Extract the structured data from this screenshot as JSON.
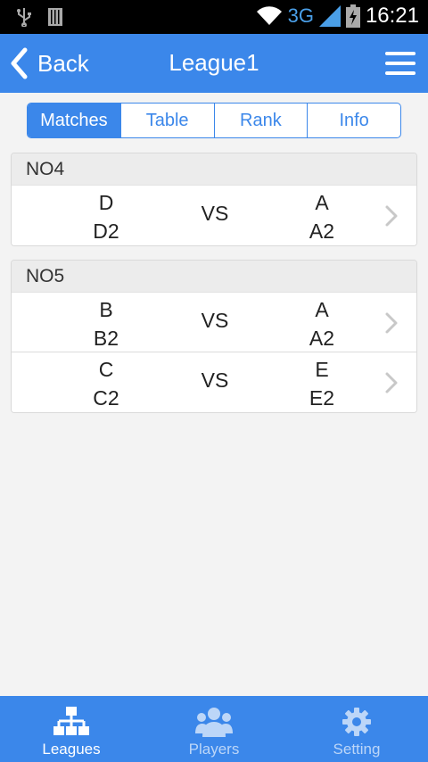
{
  "status_bar": {
    "network": "3G",
    "time": "16:21"
  },
  "nav": {
    "back_label": "Back",
    "title": "League1"
  },
  "tabs": [
    {
      "label": "Matches",
      "active": true
    },
    {
      "label": "Table",
      "active": false
    },
    {
      "label": "Rank",
      "active": false
    },
    {
      "label": "Info",
      "active": false
    }
  ],
  "rounds": [
    {
      "name": "NO4",
      "matches": [
        {
          "home": [
            "D",
            "D2"
          ],
          "vs": "VS",
          "away": [
            "A",
            "A2"
          ]
        }
      ]
    },
    {
      "name": "NO5",
      "matches": [
        {
          "home": [
            "B",
            "B2"
          ],
          "vs": "VS",
          "away": [
            "A",
            "A2"
          ]
        },
        {
          "home": [
            "C",
            "C2"
          ],
          "vs": "VS",
          "away": [
            "E",
            "E2"
          ]
        }
      ]
    }
  ],
  "bottom_nav": [
    {
      "label": "Leagues",
      "icon": "hierarchy-icon",
      "active": true
    },
    {
      "label": "Players",
      "icon": "users-icon",
      "active": false
    },
    {
      "label": "Setting",
      "icon": "gear-icon",
      "active": false
    }
  ],
  "colors": {
    "primary": "#3b87ea",
    "inactive_tab_text": "#bcd6f8"
  }
}
